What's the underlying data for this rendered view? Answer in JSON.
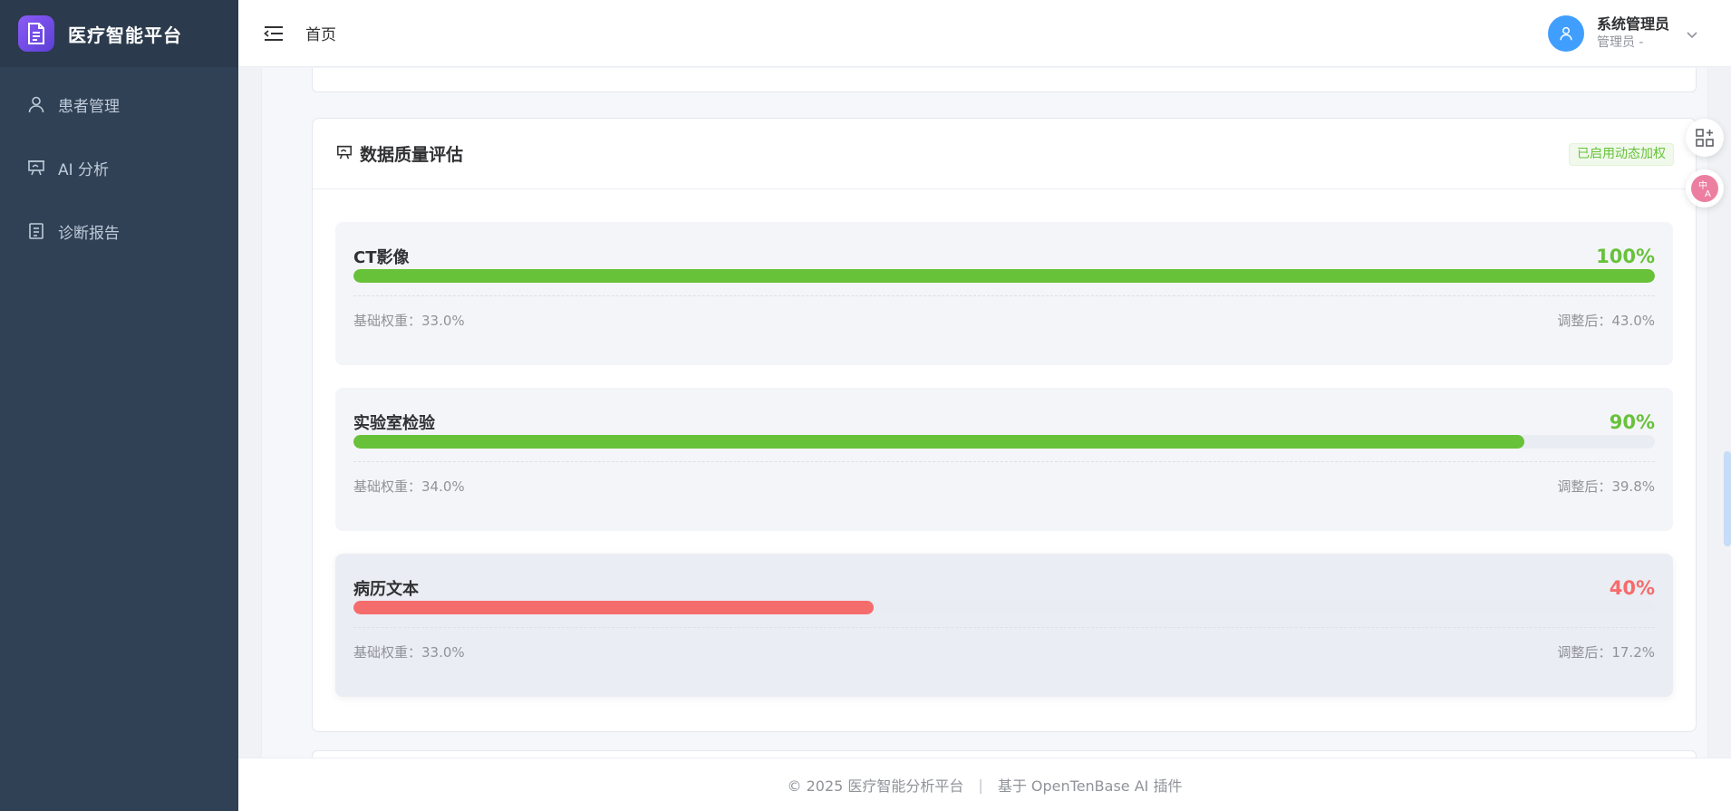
{
  "app": {
    "title": "医疗智能平台"
  },
  "sidebar": {
    "items": [
      {
        "label": "患者管理",
        "icon": "user-icon"
      },
      {
        "label": "AI 分析",
        "icon": "presentation-icon"
      },
      {
        "label": "诊断报告",
        "icon": "document-icon"
      }
    ]
  },
  "header": {
    "breadcrumb": "首页",
    "user": {
      "name": "系统管理员",
      "role": "管理员 -"
    }
  },
  "quality_card": {
    "title": "数据质量评估",
    "badge": "已启用动态加权",
    "items": [
      {
        "name": "CT影像",
        "score": "100%",
        "progress": 100,
        "color": "#67c23a",
        "base": "基础权重：33.0%",
        "adjusted": "调整后：43.0%"
      },
      {
        "name": "实验室检验",
        "score": "90%",
        "progress": 90,
        "color": "#67c23a",
        "base": "基础权重：34.0%",
        "adjusted": "调整后：39.8%"
      },
      {
        "name": "病历文本",
        "score": "40%",
        "progress": 40,
        "color": "#f56c6c",
        "base": "基础权重：33.0%",
        "adjusted": "调整后：17.2%"
      }
    ]
  },
  "footer": {
    "left": "© 2025 医疗智能分析平台",
    "separator": "|",
    "right": "基于 OpenTenBase AI 插件"
  },
  "colors": {
    "sidebar": "#304156",
    "accent": "#409eff",
    "success": "#67c23a",
    "danger": "#f56c6c"
  }
}
